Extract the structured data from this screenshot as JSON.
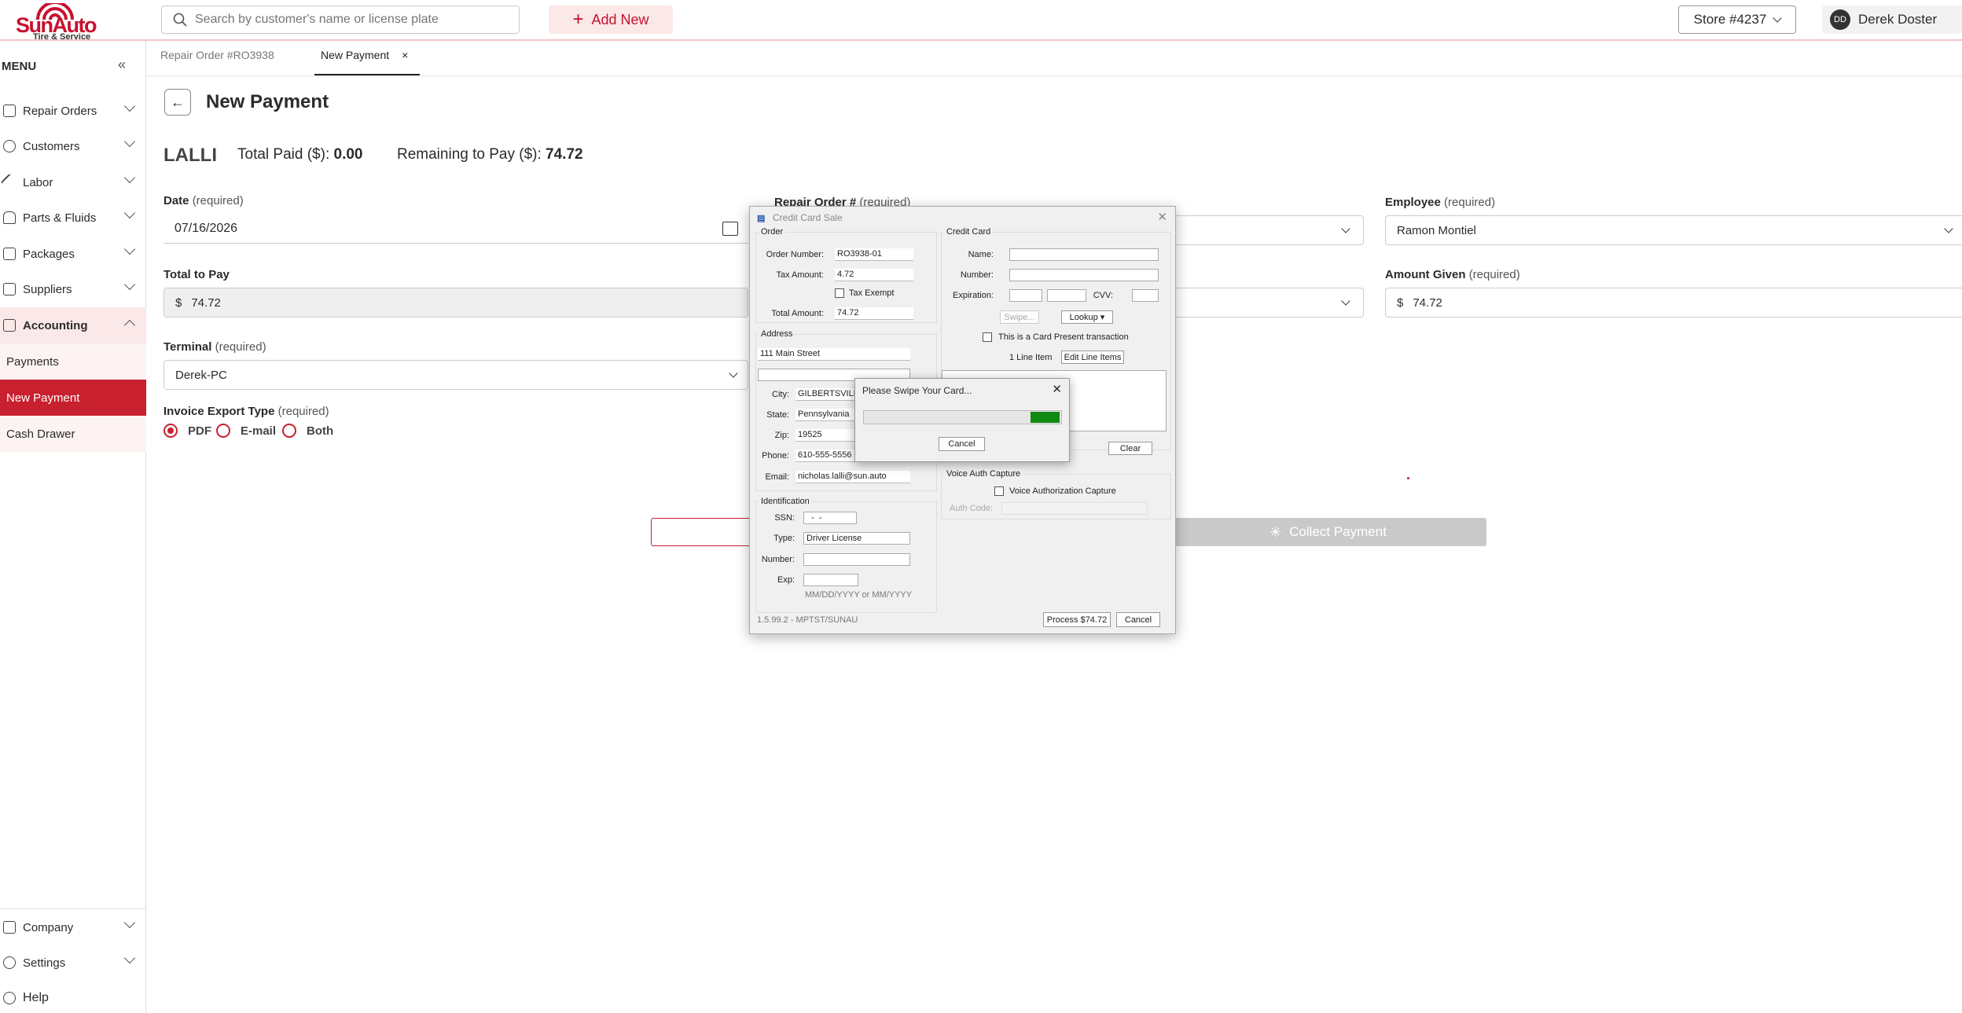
{
  "header": {
    "logo_brand": "SunAuto",
    "logo_tagline": "Tire & Service",
    "search_placeholder": "Search by customer's name or license plate",
    "add_new": "Add New",
    "store": "Store #4237",
    "user_initials": "DD",
    "user_name": "Derek Doster"
  },
  "sidebar": {
    "title": "MENU",
    "items": [
      {
        "label": "Repair Orders"
      },
      {
        "label": "Customers"
      },
      {
        "label": "Labor"
      },
      {
        "label": "Parts & Fluids"
      },
      {
        "label": "Packages"
      },
      {
        "label": "Suppliers"
      },
      {
        "label": "Accounting"
      }
    ],
    "subitems": [
      {
        "label": "Payments"
      },
      {
        "label": "New Payment"
      },
      {
        "label": "Cash Drawer"
      }
    ],
    "bottom": [
      {
        "label": "Company"
      },
      {
        "label": "Settings"
      },
      {
        "label": "Help"
      }
    ]
  },
  "tabs": [
    {
      "label": "Repair Order #RO3938"
    },
    {
      "label": "New Payment",
      "close": "×"
    }
  ],
  "page": {
    "title": "New Payment",
    "customer": "LALLI",
    "total_paid_label": "Total Paid ($):",
    "total_paid": "0.00",
    "remaining_label": "Remaining to Pay ($):",
    "remaining": "74.72",
    "date_label": "Date",
    "required": "(required)",
    "date_value": "07/16/2026",
    "repair_order_label": "Repair Order #",
    "employee_label": "Employee",
    "employee_value": "Ramon Montiel",
    "total_to_pay_label": "Total to Pay",
    "total_to_pay_value": "74.72",
    "amount_given_label": "Amount Given",
    "amount_given_value": "74.72",
    "currency": "$",
    "terminal_label": "Terminal",
    "terminal_value": "Derek-PC",
    "invoice_label": "Invoice Export Type",
    "invoice_options": [
      "PDF",
      "E-mail",
      "Both"
    ],
    "collect_label": "Collect Payment"
  },
  "dialog": {
    "title": "Credit Card Sale",
    "order_group": "Order",
    "order_number_label": "Order Number:",
    "order_number": "RO3938-01",
    "tax_amount_label": "Tax Amount:",
    "tax_amount": "4.72",
    "tax_exempt": "Tax Exempt",
    "total_amount_label": "Total Amount:",
    "total_amount": "74.72",
    "address_group": "Address",
    "street": "111 Main Street",
    "city_label": "City:",
    "city": "GILBERTSVILLE",
    "state_label": "State:",
    "state": "Pennsylvania",
    "zip_label": "Zip:",
    "zip": "19525",
    "phone_label": "Phone:",
    "phone": "610-555-5556",
    "email_label": "Email:",
    "email": "nicholas.lalli@sun.auto",
    "ident_group": "Identification",
    "ssn_label": "SSN:",
    "ssn": "  -  -",
    "type_label": "Type:",
    "type": "Driver License",
    "number_label": "Number:",
    "exp_label": "Exp:",
    "exp_hint": "MM/DD/YYYY or MM/YYYY",
    "card_group": "Credit Card",
    "name_label": "Name:",
    "card_number_label": "Number:",
    "expiration_label": "Expiration:",
    "cvv_label": "CVV:",
    "swipe_btn": "Swipe...",
    "lookup_btn": "Lookup",
    "card_present": "This is a Card Present transaction",
    "line_items": "1 Line Item",
    "edit_line_items": "Edit Line Items",
    "clear_btn": "Clear",
    "voice_group": "Voice Auth Capture",
    "voice_check": "Voice Authorization Capture",
    "auth_code_label": "Auth Code:",
    "version": "1.5.99.2 - MPTST/SUNAU",
    "process_btn": "Process $74.72",
    "cancel_btn": "Cancel"
  },
  "swipe": {
    "title": "Please Swipe Your Card...",
    "progress": 0.15,
    "cancel": "Cancel"
  }
}
